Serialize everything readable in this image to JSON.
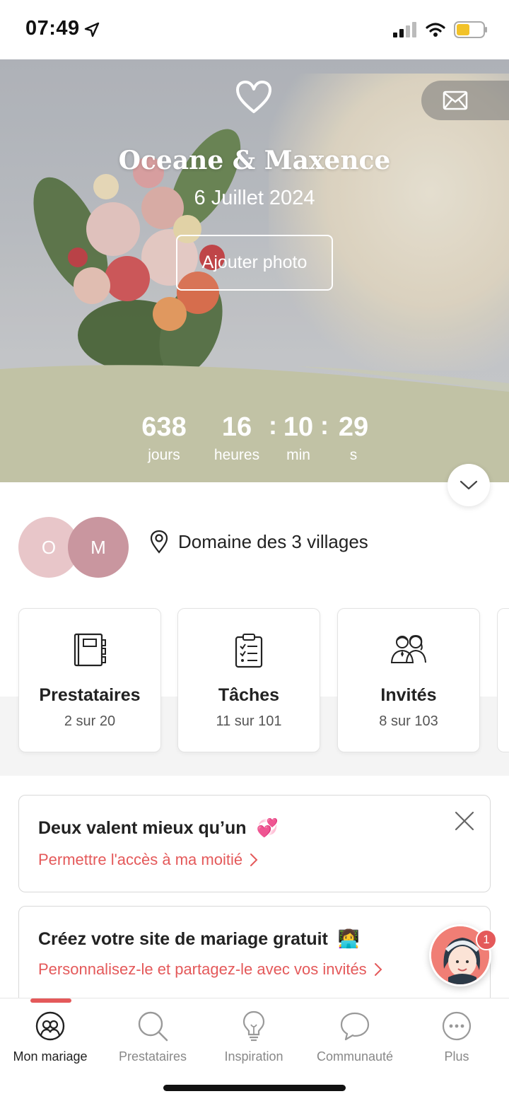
{
  "status_bar": {
    "time": "07:49"
  },
  "hero": {
    "couple": "Oceane & Maxence",
    "date": "6 Juillet 2024",
    "add_photo_label": "Ajouter photo"
  },
  "countdown": {
    "days": "638",
    "days_label": "jours",
    "hours": "16",
    "hours_label": "heures",
    "minutes": "10",
    "minutes_label": "min",
    "seconds": "29",
    "seconds_label": "s",
    "separator": ":"
  },
  "couple_avatars": {
    "first_initial": "O",
    "second_initial": "M"
  },
  "venue": "Domaine des 3 villages",
  "cards": [
    {
      "title": "Prestataires",
      "count": "2 sur 20",
      "icon": "notebook-icon"
    },
    {
      "title": "Tâches",
      "count": "11 sur 101",
      "icon": "checklist-icon"
    },
    {
      "title": "Invités",
      "count": "8 sur 103",
      "icon": "guests-icon"
    }
  ],
  "promos": [
    {
      "title": "Deux valent mieux qu’un",
      "emoji": "💞",
      "link": "Permettre l'accès à ma moitié"
    },
    {
      "title": "Créez votre site de mariage gratuit",
      "emoji": "👩‍💻",
      "link": "Personnalisez-le et partagez-le avec vos invités"
    }
  ],
  "chat": {
    "badge": "1"
  },
  "nav": [
    {
      "label": "Mon mariage",
      "icon": "rings-icon"
    },
    {
      "label": "Prestataires",
      "icon": "search-icon"
    },
    {
      "label": "Inspiration",
      "icon": "lightbulb-icon"
    },
    {
      "label": "Communauté",
      "icon": "chat-bubble-icon"
    },
    {
      "label": "Plus",
      "icon": "more-icon"
    }
  ],
  "colors": {
    "accent": "#e4595a",
    "countdown_band": "#c1c2a5",
    "avatar_o": "#e8c6c9",
    "avatar_m": "#c9969f"
  }
}
